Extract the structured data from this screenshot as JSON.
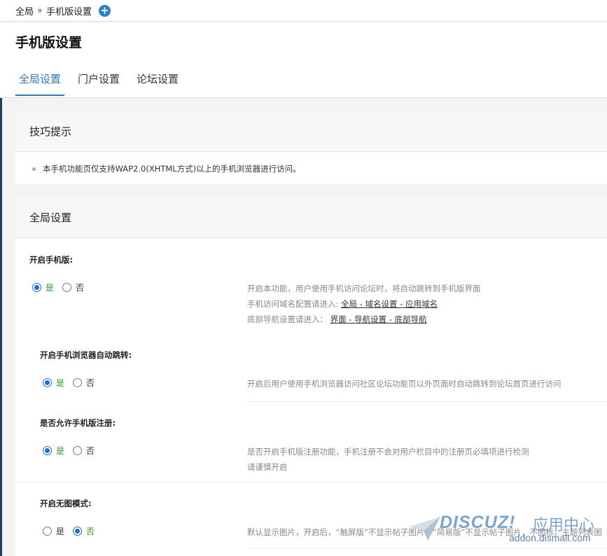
{
  "breadcrumb": {
    "root": "全局",
    "sep": "»",
    "current": "手机版设置",
    "add_icon": "plus-icon"
  },
  "page": {
    "title": "手机版设置"
  },
  "tabs": [
    {
      "label": "全局设置",
      "active": true
    },
    {
      "label": "门户设置",
      "active": false
    },
    {
      "label": "论坛设置",
      "active": false
    }
  ],
  "tips": {
    "title": "技巧提示",
    "items": [
      "本手机功能页仅支持WAP2.0(XHTML方式)以上的手机浏览器进行访问。"
    ]
  },
  "global": {
    "title": "全局设置",
    "yes": "是",
    "no": "否",
    "settings": [
      {
        "label": "开启手机版:",
        "value": "是",
        "desc1": "开启本功能，用户使用手机访问论坛时，将自动跳转到手机版界面",
        "desc2_prefix": "手机访问域名配置请进入: ",
        "desc2_link": "全局 - 域名设置 - 应用域名",
        "desc3_prefix": "底部导航设置请进入： ",
        "desc3_link": "界面 - 导航设置 - 底部导航"
      },
      {
        "label": "开启手机浏览器自动跳转:",
        "value": "是",
        "desc1": "开启后用户使用手机浏览器访问社区论坛功能页以外页面时自动跳转到论坛首页进行访问"
      },
      {
        "label": "是否允许手机版注册:",
        "value": "是",
        "desc1": "是否开启手机版注册功能，手机注册不会对用户栏目中的注册页必填项进行检测",
        "desc2": "请谨慎开启"
      },
      {
        "label": "开启无图模式:",
        "value": "否",
        "desc1": "默认显示图片，开启后，“触屏版”不显示帖子图片，“简易版”不显示帖子图片，不图标，主题列表图"
      }
    ]
  },
  "watermark": {
    "brand": "DISCUZ!",
    "cn": "应用中心",
    "url": "addon.dismall.com"
  },
  "colors": {
    "accent": "#2e78b6",
    "selected_text": "#2a9a2a",
    "radio": "#1e6fd0"
  }
}
